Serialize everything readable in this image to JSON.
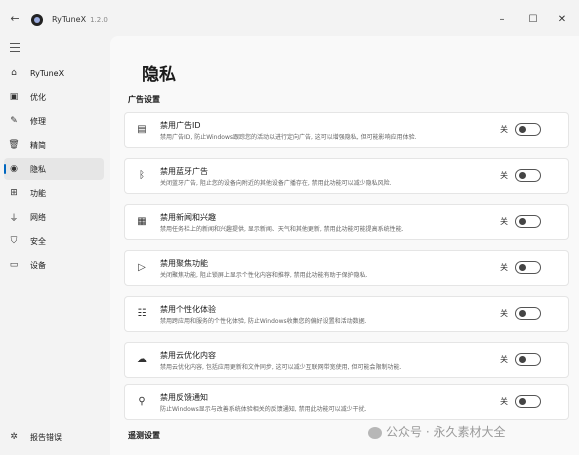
{
  "window": {
    "app_title": "RyTuneX",
    "app_version": "1.2.0",
    "icons": {
      "back": "back-arrow-icon",
      "minimize": "minimize-icon",
      "maximize": "maximize-icon",
      "close": "close-icon"
    },
    "glyphs": {
      "back": "←",
      "minimize": "–",
      "maximize": "☐",
      "close": "✕"
    }
  },
  "sidebar": {
    "items": [
      {
        "label": "RyTuneX",
        "icon": "home-icon",
        "glyph": "⌂",
        "active": false
      },
      {
        "label": "优化",
        "icon": "optimize-icon",
        "glyph": "▣",
        "active": false
      },
      {
        "label": "修理",
        "icon": "repair-icon",
        "glyph": "✎",
        "active": false
      },
      {
        "label": "精简",
        "icon": "trash-icon",
        "glyph": "🗑",
        "active": false
      },
      {
        "label": "隐私",
        "icon": "privacy-icon",
        "glyph": "◉",
        "active": true
      },
      {
        "label": "功能",
        "icon": "features-icon",
        "glyph": "⊞",
        "active": false
      },
      {
        "label": "网络",
        "icon": "network-icon",
        "glyph": "⏚",
        "active": false
      },
      {
        "label": "安全",
        "icon": "shield-icon",
        "glyph": "⛉",
        "active": false
      },
      {
        "label": "设备",
        "icon": "device-icon",
        "glyph": "▭",
        "active": false
      }
    ],
    "feedback": {
      "label": "报告错误",
      "icon": "bug-icon",
      "glyph": "✲"
    }
  },
  "main": {
    "title": "隐私",
    "section_ad": "广告设置",
    "section_telemetry": "遥测设置",
    "cards": [
      {
        "title": "禁用广告ID",
        "desc": "禁用广告ID, 防止Windows跟踪您的活动以进行定向广告, 这可以增强隐私, 但可能影响应用体验.",
        "icon": "ad-id-icon",
        "glyph": "▤",
        "toggle_label": "关"
      },
      {
        "title": "禁用蓝牙广告",
        "desc": "关闭蓝牙广告, 阻止您的设备向附近的其他设备广播存在, 禁用此功能可以减少隐私风险.",
        "icon": "bluetooth-icon",
        "glyph": "ᛒ",
        "toggle_label": "关"
      },
      {
        "title": "禁用新闻和兴趣",
        "desc": "禁用任务栏上的新闻和兴趣提供, 显示新闻、天气和其他更新, 禁用此功能可能提高系统性能.",
        "icon": "news-icon",
        "glyph": "▦",
        "toggle_label": "关"
      },
      {
        "title": "禁用聚焦功能",
        "desc": "关闭聚焦功能, 阻止锁屏上显示个性化内容和推荐, 禁用此功能有助于保护隐私.",
        "icon": "spotlight-icon",
        "glyph": "▷",
        "toggle_label": "关"
      },
      {
        "title": "禁用个性化体验",
        "desc": "禁用跨应用和服务的个性化体验, 防止Windows收集您的偏好设置和活动数据.",
        "icon": "personalize-icon",
        "glyph": "☷",
        "toggle_label": "关"
      },
      {
        "title": "禁用云优化内容",
        "desc": "禁用云优化内容, 包括应用更新和文件同步, 这可以减少互联网带宽使用, 但可能会限制功能.",
        "icon": "cloud-icon",
        "glyph": "☁",
        "toggle_label": "关"
      },
      {
        "title": "禁用反馈通知",
        "desc": "防止Windows显示与改善系统体验相关的反馈通知, 禁用此功能可以减少干扰.",
        "icon": "feedback-icon",
        "glyph": "⚲",
        "toggle_label": "关"
      }
    ]
  },
  "watermark": {
    "text": "公众号 · 永久素材大全"
  }
}
